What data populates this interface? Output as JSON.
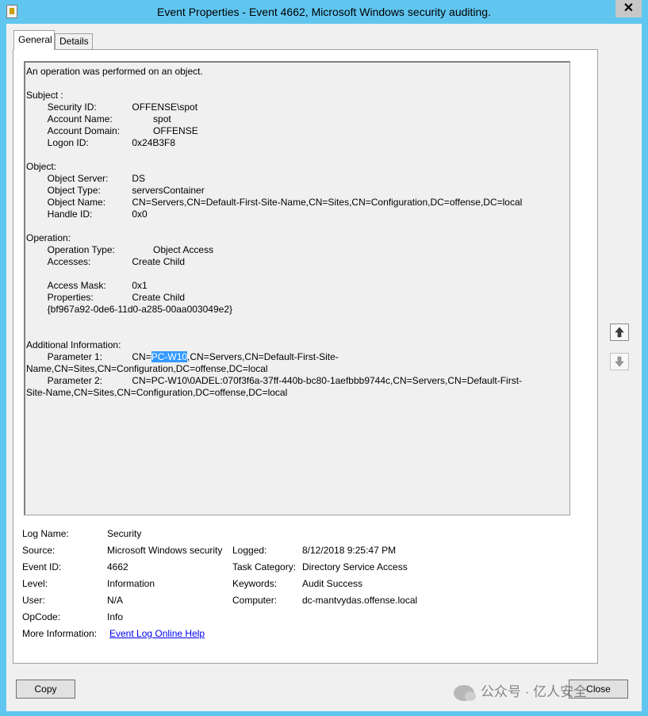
{
  "window": {
    "title": "Event Properties - Event 4662, Microsoft Windows security auditing.",
    "close_glyph": "✕"
  },
  "tabs": [
    {
      "label": "General"
    },
    {
      "label": "Details"
    }
  ],
  "description": {
    "pre": "An operation was performed on an object.\n\nSubject :\n\tSecurity ID:\t\tOFFENSE\\spot\n\tAccount Name:\t\tspot\n\tAccount Domain:\t\tOFFENSE\n\tLogon ID:\t\t0x24B3F8\n\nObject:\n\tObject Server:\t\tDS\n\tObject Type:\t\tserversContainer\n\tObject Name:\t\tCN=Servers,CN=Default-First-Site-Name,CN=Sites,CN=Configuration,DC=offense,DC=local\n\tHandle ID:\t\t0x0\n\nOperation:\n\tOperation Type:\t\tObject Access\n\tAccesses:\t\tCreate Child\n\t\t\t\t\n\tAccess Mask:\t\t0x1\n\tProperties:\t\tCreate Child\n\t{bf967a92-0de6-11d0-a285-00aa003049e2}\n\n\nAdditional Information:\n\tParameter 1:\t\tCN=",
    "highlight": "PC-W10",
    "post": ",CN=Servers,CN=Default-First-Site-\nName,CN=Sites,CN=Configuration,DC=offense,DC=local\n\tParameter 2:\t\tCN=PC-W10\\0ADEL:070f3f6a-37ff-440b-bc80-1aefbbb9744c,CN=Servers,CN=Default-First-\nSite-Name,CN=Sites,CN=Configuration,DC=offense,DC=local"
  },
  "meta": {
    "log_name_label": "Log Name:",
    "log_name": "Security",
    "source_label": "Source:",
    "source": "Microsoft Windows security",
    "logged_label": "Logged:",
    "logged": "8/12/2018 9:25:47 PM",
    "event_id_label": "Event ID:",
    "event_id": "4662",
    "task_category_label": "Task Category:",
    "task_category": "Directory Service Access",
    "level_label": "Level:",
    "level": "Information",
    "keywords_label": "Keywords:",
    "keywords": "Audit Success",
    "user_label": "User:",
    "user": "N/A",
    "computer_label": "Computer:",
    "computer": "dc-mantvydas.offense.local",
    "opcode_label": "OpCode:",
    "opcode": "Info",
    "more_info_label": "More Information:",
    "more_info_link": "Event Log Online Help"
  },
  "buttons": {
    "copy": "Copy",
    "close": "Close"
  },
  "watermark": {
    "text": "公众号 · 亿人安全"
  },
  "colors": {
    "titlebar": "#60c6f0",
    "selection": "#3399ff",
    "link": "#0000ee"
  }
}
